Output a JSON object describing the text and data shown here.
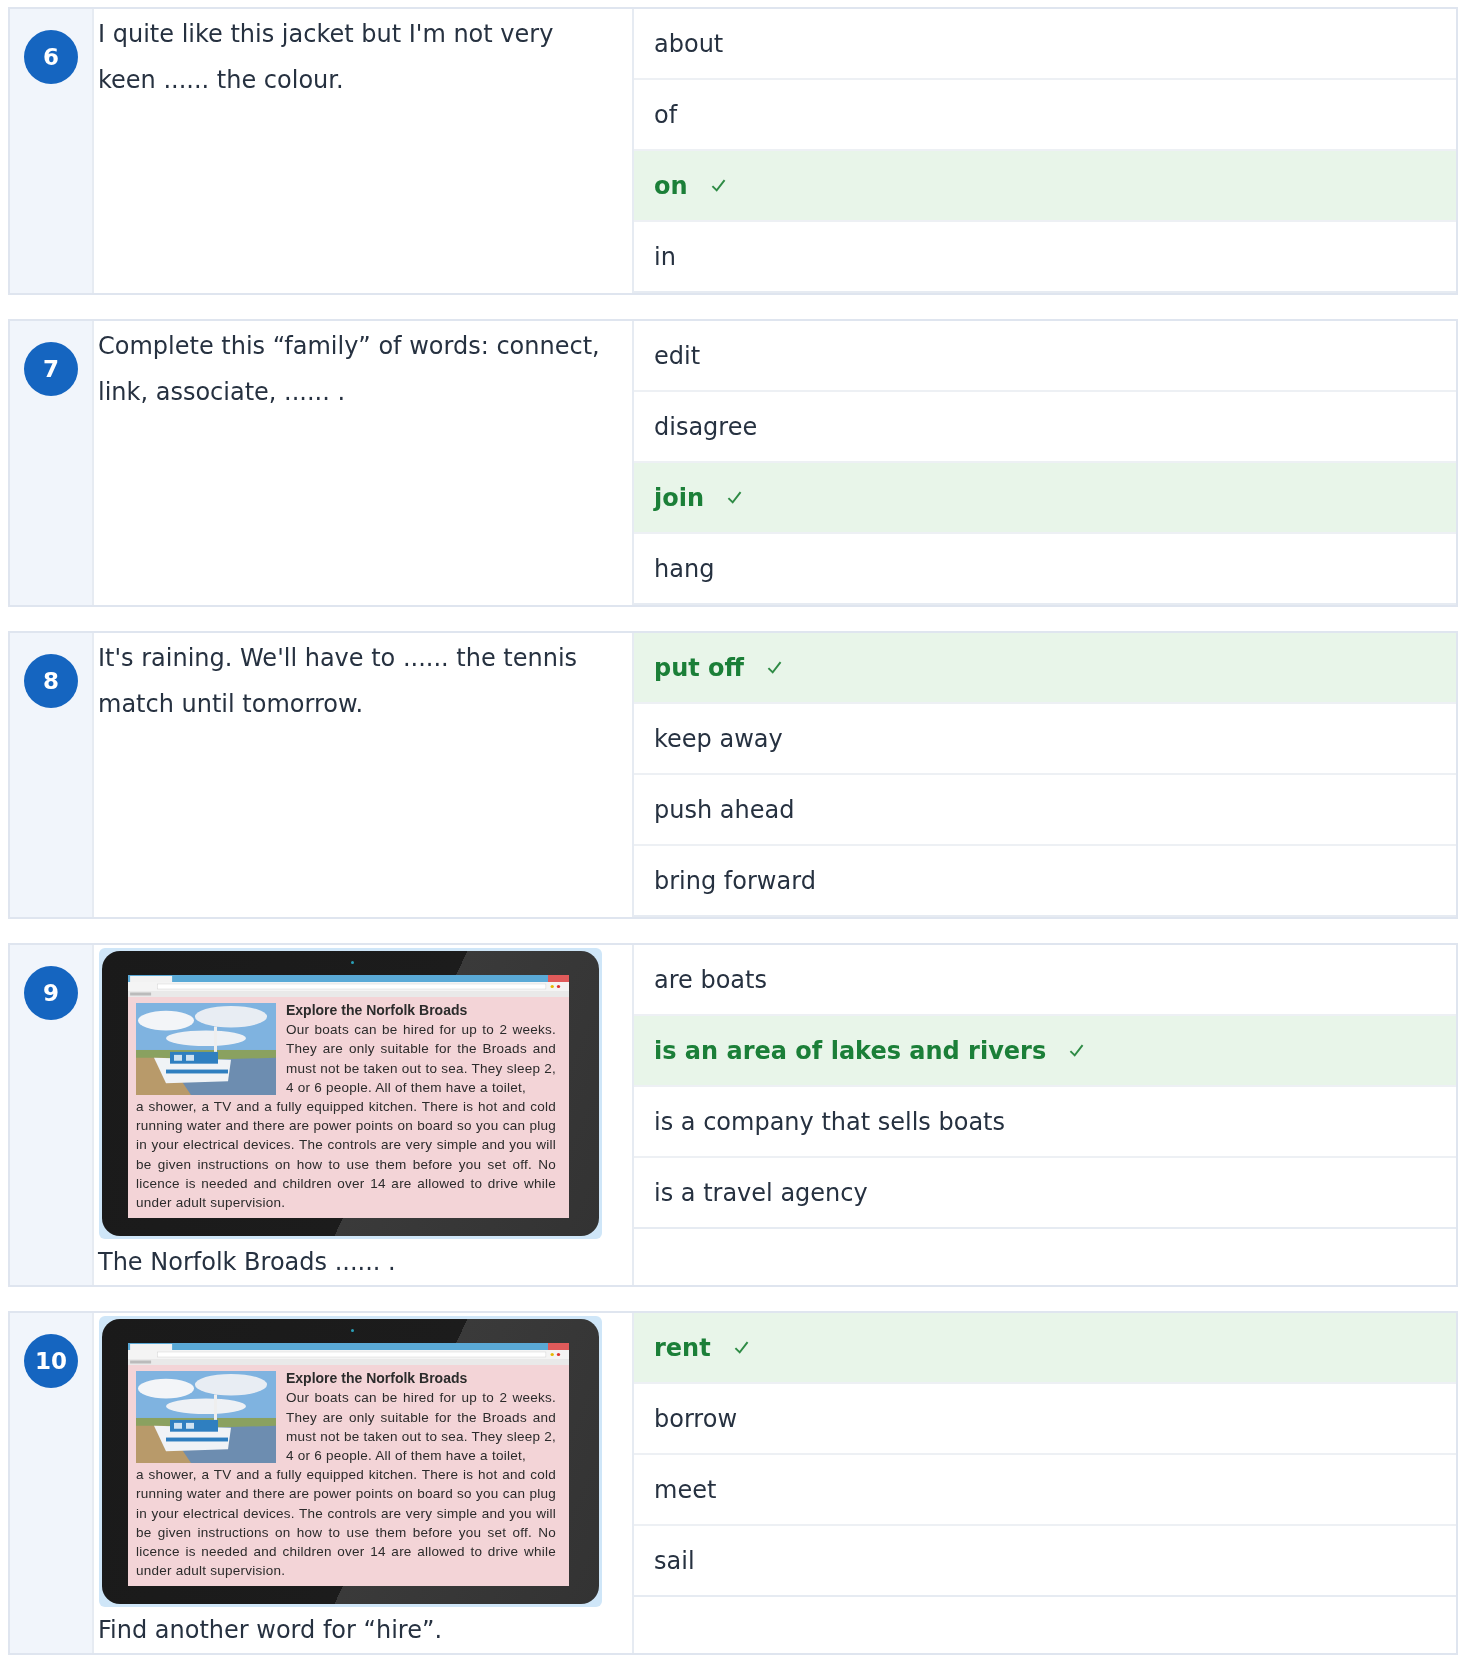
{
  "questions": [
    {
      "number": "6",
      "prompt": "I quite like this jacket but I'm not very keen ...... the colour.",
      "answers": [
        {
          "text": "about",
          "selected": false
        },
        {
          "text": "of",
          "selected": false
        },
        {
          "text": "on",
          "selected": true
        },
        {
          "text": "in",
          "selected": false
        }
      ]
    },
    {
      "number": "7",
      "prompt": "Complete this “family” of words: connect, link, associate, ...... .",
      "answers": [
        {
          "text": "edit",
          "selected": false
        },
        {
          "text": "disagree",
          "selected": false
        },
        {
          "text": "join",
          "selected": true
        },
        {
          "text": "hang",
          "selected": false
        }
      ]
    },
    {
      "number": "8",
      "prompt": "It's raining. We'll have to ...... the tennis match until tomorrow.",
      "answers": [
        {
          "text": "put off",
          "selected": true
        },
        {
          "text": "keep away",
          "selected": false
        },
        {
          "text": "push ahead",
          "selected": false
        },
        {
          "text": "bring forward",
          "selected": false
        }
      ]
    },
    {
      "number": "9",
      "figure": {
        "heading": "Explore the Norfolk Broads",
        "body_beside": "Our boats can be hired for up to 2 weeks. They are only suitable for the Broads and must not be taken out to sea. They sleep 2, 4 or 6 people. All of them have a toilet,",
        "body_below": "a shower, a TV and a fully equipped kitchen. There is hot and cold running water and there are power points on board so you can plug in your electrical devices. The controls are very simple and you will be given instructions on how to use them before you set off. No licence is needed and children over 14 are allowed to drive while under adult supervision."
      },
      "prompt": "The Norfolk Broads ...... .",
      "answers": [
        {
          "text": "are boats",
          "selected": false
        },
        {
          "text": "is an area of lakes and rivers",
          "selected": true
        },
        {
          "text": "is a company that sells boats",
          "selected": false
        },
        {
          "text": "is a travel agency",
          "selected": false
        }
      ]
    },
    {
      "number": "10",
      "figure": {
        "heading": "Explore the Norfolk Broads",
        "body_beside": "Our boats can be hired for up to 2 weeks. They are only suitable for the Broads and must not be taken out to sea. They sleep 2, 4 or 6 people. All of them have a toilet,",
        "body_below": "a shower, a TV and a fully equipped kitchen. There is hot and cold running water and there are power points on board so you can plug in your electrical devices. The controls are very simple and you will be given instructions on how to use them before you set off. No licence is needed and children over 14 are allowed to drive while under adult supervision."
      },
      "prompt": "Find another word for “hire”.",
      "answers": [
        {
          "text": "rent",
          "selected": true
        },
        {
          "text": "borrow",
          "selected": false
        },
        {
          "text": "meet",
          "selected": false
        },
        {
          "text": "sail",
          "selected": false
        }
      ]
    }
  ]
}
